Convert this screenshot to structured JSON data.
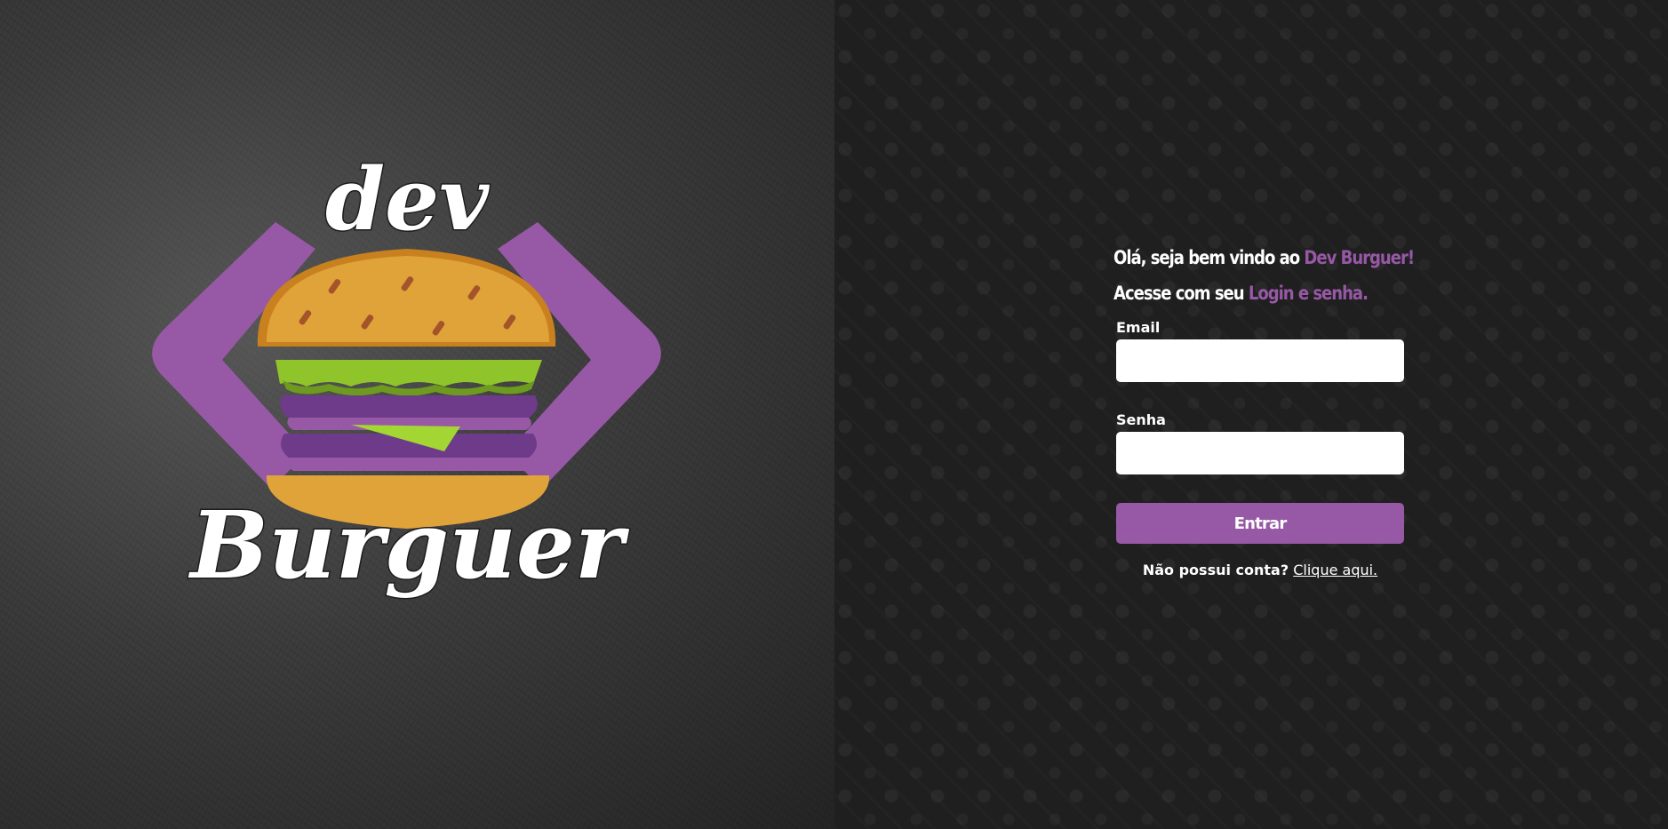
{
  "brand": {
    "logo_word_top": "dev",
    "logo_word_bottom": "Burguer",
    "colors": {
      "accent": "#9758a6",
      "bun": "#e0a33a",
      "bun_dark": "#c9811f",
      "lettuce": "#8fc42b",
      "patty": "#6e3b8a",
      "text": "#ffffff"
    }
  },
  "login": {
    "greeting_prefix": "Olá, seja bem vindo ao",
    "greeting_brand": "Dev Burguer!",
    "instruction_prefix": "Acesse com seu",
    "instruction_accent": "Login e senha.",
    "email_label": "Email",
    "email_value": "",
    "password_label": "Senha",
    "password_value": "",
    "submit_label": "Entrar",
    "signup_question": "Não possui conta?",
    "signup_link": "Clique aqui."
  }
}
